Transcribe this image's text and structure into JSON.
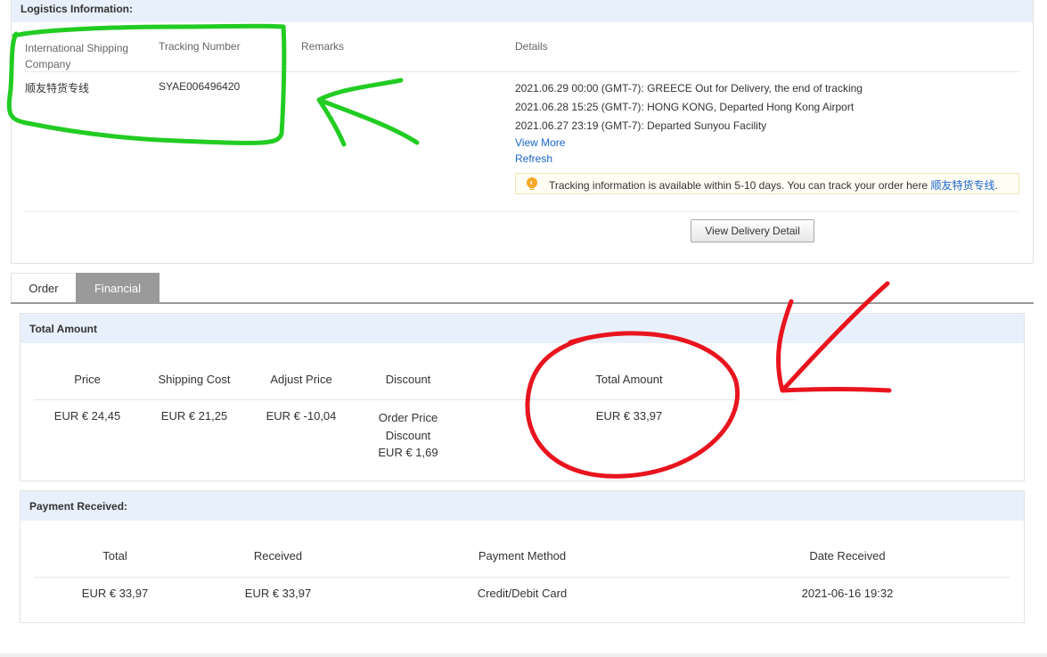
{
  "logistics": {
    "heading": "Logistics Information:",
    "columns": {
      "company": "International Shipping Company",
      "company_line1": "International Shipping",
      "company_line2": "Company",
      "tracking": "Tracking Number",
      "remarks": "Remarks",
      "details": "Details"
    },
    "company_value": "顺友特货专线",
    "tracking_value": "SYAE006496420",
    "events": [
      "2021.06.29 00:00 (GMT-7): GREECE Out for Delivery, the end of tracking",
      "2021.06.28 15:25 (GMT-7): HONG KONG, Departed Hong Kong Airport",
      "2021.06.27 23:19 (GMT-7): Departed Sunyou Facility"
    ],
    "view_more": "View More",
    "refresh": "Refresh",
    "notice_text": "Tracking information is available within 5-10 days. You can track your order here ",
    "notice_link": "顺友特货专线",
    "notice_end": ".",
    "view_delivery_button": "View Delivery Detail"
  },
  "tabs": [
    {
      "label": "Order",
      "active": false
    },
    {
      "label": "Financial",
      "active": true
    }
  ],
  "total_amount": {
    "heading": "Total Amount",
    "columns": [
      "Price",
      "Shipping Cost",
      "Adjust Price",
      "Discount",
      "Total Amount"
    ],
    "values": {
      "price": "EUR € 24,45",
      "shipping": "EUR € 21,25",
      "adjust": "EUR € -10,04",
      "discount_line1": "Order Price",
      "discount_line2": "Discount",
      "discount_line3": "EUR € 1,69",
      "total": "EUR € 33,97"
    }
  },
  "payment": {
    "heading": "Payment Received:",
    "columns": [
      "Total",
      "Received",
      "Payment Method",
      "Date Received"
    ],
    "values": [
      "EUR € 33,97",
      "EUR € 33,97",
      "Credit/Debit Card",
      "2021-06-16 19:32"
    ]
  },
  "colors": {
    "header_bg": "#e8f0fb",
    "link": "#1a66c9",
    "active_tab": "#9a9a9a",
    "annotation_green": "#22cc22",
    "annotation_red": "#e8141e",
    "notice_icon": "#f5a623"
  },
  "icons": {
    "notice": "lightbulb-icon"
  }
}
